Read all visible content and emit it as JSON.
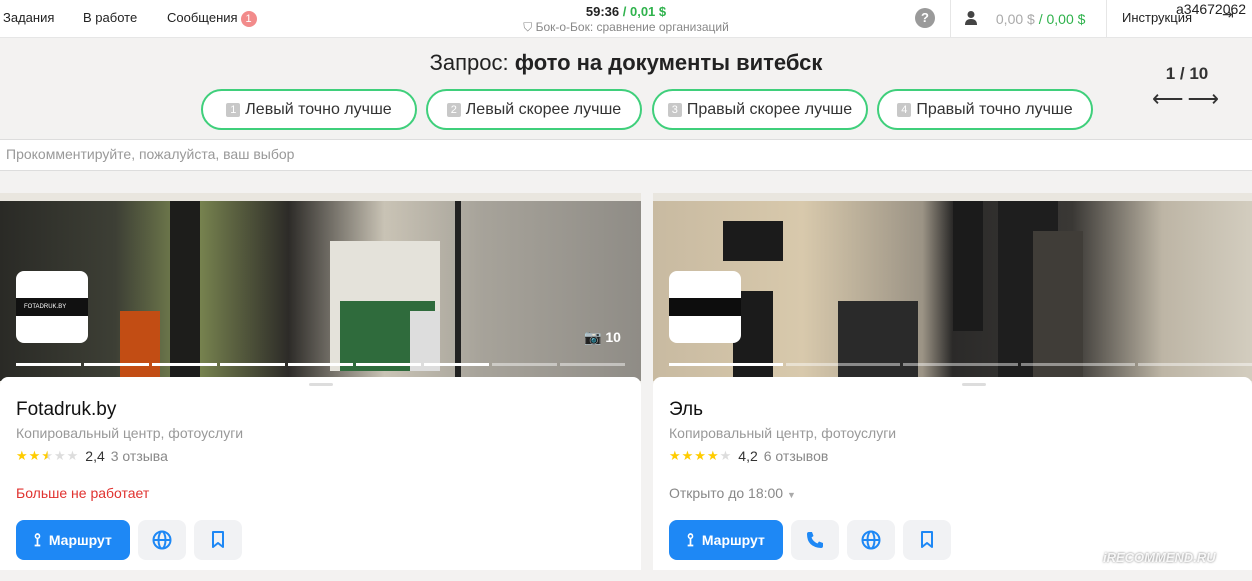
{
  "nav": {
    "tasks": "Задания",
    "in_work": "В работе",
    "messages": "Сообщения",
    "messages_count": "1"
  },
  "timer": {
    "time": "59:36",
    "sep": "/",
    "reward": "0,01 $",
    "subtitle": "Бок-о-Бок: сравнение организаций"
  },
  "help": "?",
  "balance": {
    "value1": "0,00 $",
    "sep": "/",
    "value2": "0,00 $"
  },
  "instructions": "Инструкция",
  "login": "a34672062",
  "query": {
    "label": "Запрос:",
    "text": "фото на документы витебск"
  },
  "counter": "1 / 10",
  "choices": [
    {
      "key": "1",
      "label": "Левый точно лучше"
    },
    {
      "key": "2",
      "label": "Левый скорее лучше"
    },
    {
      "key": "3",
      "label": "Правый скорее лучше"
    },
    {
      "key": "4",
      "label": "Правый точно лучше"
    }
  ],
  "comment_placeholder": "Прокомментируйте, пожалуйста, ваш выбор",
  "left": {
    "name": "Fotadruk.by",
    "category": "Копировальный центр, фотоуслуги",
    "rating": "2,4",
    "rating_value": 2.5,
    "reviews": "3 отзыва",
    "status": "Больше не работает",
    "photos": "10",
    "logo_text": "FOTADRUK.BY",
    "route": "Маршрут",
    "photo_progress": {
      "segments": 9,
      "active": 7
    }
  },
  "right": {
    "name": "Эль",
    "category": "Копировальный центр, фотоуслуги",
    "rating": "4,2",
    "rating_value": 4,
    "reviews": "6 отзывов",
    "status": "Открыто до 18:00",
    "route": "Маршрут",
    "photo_progress": {
      "segments": 5,
      "active": 1
    }
  },
  "watermark": "iRECOMMEND.RU",
  "colors": {
    "accent": "#1e88f5",
    "choice_border": "#3fcf7b",
    "money": "#2fb24c",
    "closed": "#e0322f"
  }
}
